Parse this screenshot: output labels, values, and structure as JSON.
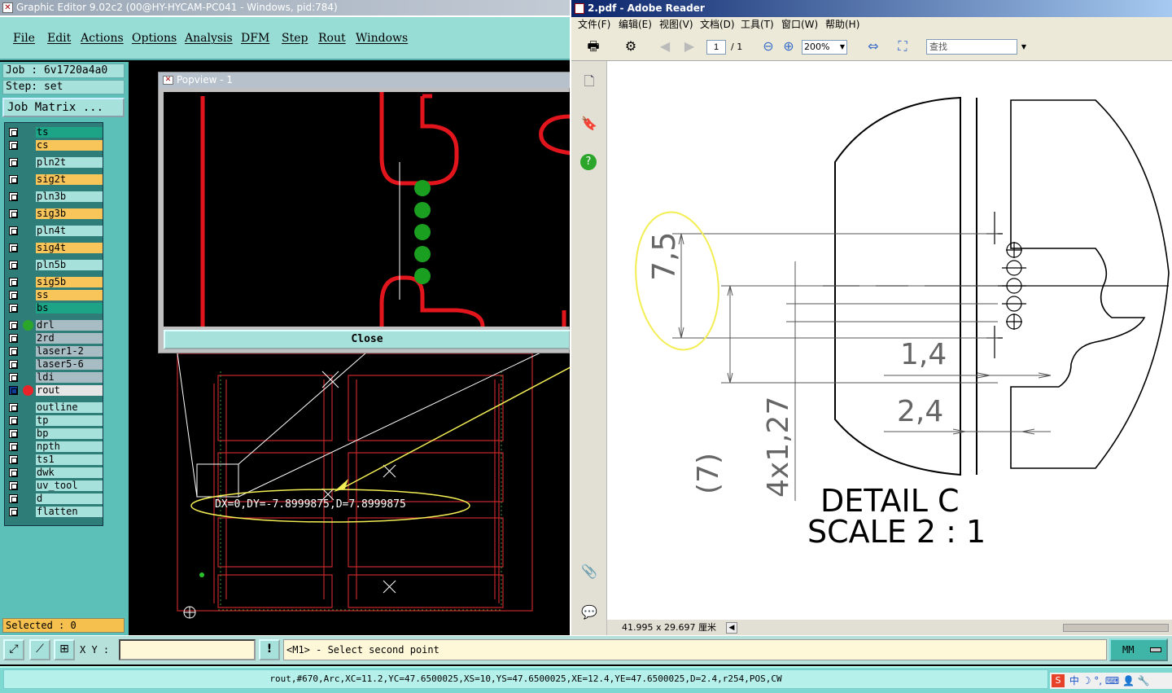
{
  "graphic_editor": {
    "title": "Graphic Editor 9.02c2 (00@HY-HYCAM-PC041 - Windows, pid:784)",
    "menu": [
      "File",
      "Edit",
      "Actions",
      "Options",
      "Analysis",
      "DFM",
      "Step",
      "Rout",
      "Windows"
    ],
    "job_label": "Job : 6v1720a4a0",
    "step_label": "Step: set",
    "job_matrix_label": "Job Matrix ...",
    "layers": [
      {
        "name": "ts",
        "color": "#1da386"
      },
      {
        "name": "cs",
        "color": "#f7c55a"
      },
      {
        "name": "pln2t",
        "color": "#a6e1dc"
      },
      {
        "name": "sig2t",
        "color": "#f7c55a"
      },
      {
        "name": "pln3b",
        "color": "#a6e1dc"
      },
      {
        "name": "sig3b",
        "color": "#f7c55a"
      },
      {
        "name": "pln4t",
        "color": "#a6e1dc"
      },
      {
        "name": "sig4t",
        "color": "#f7c55a"
      },
      {
        "name": "pln5b",
        "color": "#a6e1dc"
      },
      {
        "name": "sig5b",
        "color": "#f7c55a"
      },
      {
        "name": "ss",
        "color": "#f7c55a"
      },
      {
        "name": "bs",
        "color": "#1da386"
      },
      {
        "name": "drl",
        "color": "#a8bcc4"
      },
      {
        "name": "2rd",
        "color": "#a8bcc4"
      },
      {
        "name": "laser1-2",
        "color": "#a8bcc4"
      },
      {
        "name": "laser5-6",
        "color": "#a8bcc4"
      },
      {
        "name": "ldi",
        "color": "#a8bcc4"
      },
      {
        "name": "rout",
        "color": "#e6e6e6"
      },
      {
        "name": "outline",
        "color": "#a6e1dc"
      },
      {
        "name": "tp",
        "color": "#a6e1dc"
      },
      {
        "name": "bp",
        "color": "#a6e1dc"
      },
      {
        "name": "npth",
        "color": "#a6e1dc"
      },
      {
        "name": "ts1",
        "color": "#a6e1dc"
      },
      {
        "name": "dwk",
        "color": "#a6e1dc"
      },
      {
        "name": "uv_tool",
        "color": "#a6e1dc"
      },
      {
        "name": "d",
        "color": "#a6e1dc"
      },
      {
        "name": "flatten",
        "color": "#a6e1dc"
      }
    ],
    "selected_label": "Selected : 0",
    "popview_title": "Popview - 1",
    "close_label": "Close",
    "measurement": "DX=0,DY=-7.8999875,D=7.8999875",
    "xy_label": "X Y :",
    "prompt": "<M1> - Select second point",
    "units": "MM",
    "status": "rout,#670,Arc,XC=11.2,YC=47.6500025,XS=10,YS=47.6500025,XE=12.4,YE=47.6500025,D=2.4,r254,POS,CW"
  },
  "adobe": {
    "title": "2.pdf - Adobe Reader",
    "menu": [
      "文件(F)",
      "编辑(E)",
      "视图(V)",
      "文档(D)",
      "工具(T)",
      "窗口(W)",
      "帮助(H)"
    ],
    "page_current": "1",
    "page_total": "/ 1",
    "zoom": "200%",
    "search_placeholder": "查找",
    "page_size": "41.995 x 29.697 厘米",
    "drawing": {
      "dim_75": "7,5",
      "dim_7": "(7)",
      "dim_14": "1,4",
      "dim_24": "2,4",
      "dim_4x": "4x1,27",
      "detail": "DETAIL C",
      "scale": "SCALE 2 : 1"
    }
  },
  "tray_text": "中"
}
